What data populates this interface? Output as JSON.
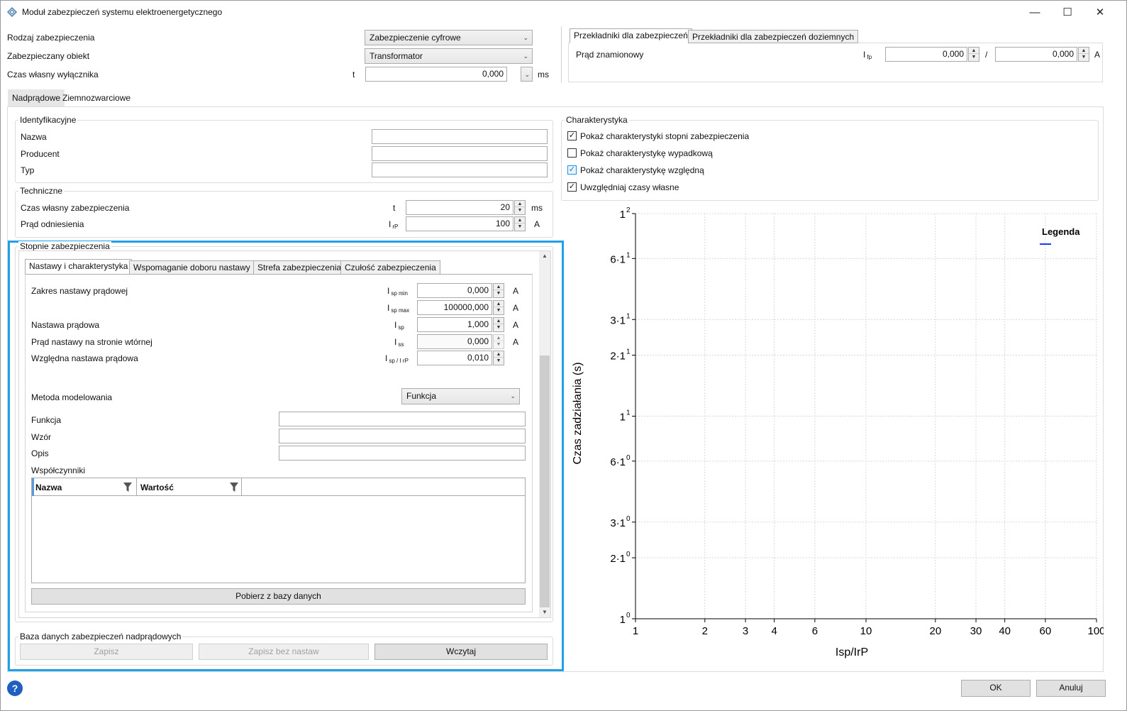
{
  "window": {
    "title": "Moduł zabezpieczeń systemu elektroenergetycznego",
    "minimize": "—",
    "maximize": "☐",
    "close": "✕"
  },
  "top": {
    "type_label": "Rodzaj zabezpieczenia",
    "type_value": "Zabezpieczenie cyfrowe",
    "object_label": "Zabezpieczany obiekt",
    "object_value": "Transformator",
    "breaker_label": "Czas własny wyłącznika",
    "breaker_sym": "t",
    "breaker_value": "0,000",
    "breaker_unit": "ms"
  },
  "transformers": {
    "tabs": [
      "Przekładniki dla zabezpieczeń",
      "Przekładniki dla zabezpieczeń doziemnych"
    ],
    "rated_label": "Prąd znamionowy",
    "sym": "I",
    "sym_sub": "fp",
    "value1": "0,000",
    "sep": "/",
    "value2": "0,000",
    "unit": "A"
  },
  "main_tabs": [
    "Nadprądowe",
    "Ziemnozwarciowe"
  ],
  "ident": {
    "title": "Identyfikacyjne",
    "name_label": "Nazwa",
    "producer_label": "Producent",
    "type_label": "Typ"
  },
  "tech": {
    "title": "Techniczne",
    "own_time_label": "Czas własny zabezpieczenia",
    "own_time_sym": "t",
    "own_time_value": "20",
    "own_time_unit": "ms",
    "ref_label": "Prąd odniesienia",
    "ref_sym": "I",
    "ref_sub": "rP",
    "ref_value": "100",
    "ref_unit": "A"
  },
  "stages": {
    "title": "Stopnie zabezpieczenia",
    "tabs": [
      "Nastawy i charakterystyka",
      "Wspomaganie doboru nastawy",
      "Strefa zabezpieczenia",
      "Czułość zabezpieczenia"
    ],
    "range_label": "Zakres nastawy prądowej",
    "min_sym": "I",
    "min_sub": "sp min",
    "min_value": "0,000",
    "min_unit": "A",
    "max_sym": "I",
    "max_sub": "sp max",
    "max_value": "100000,000",
    "max_unit": "A",
    "setting_label": "Nastawa prądowa",
    "setting_sym": "I",
    "setting_sub": "sp",
    "setting_value": "1,000",
    "setting_unit": "A",
    "secondary_label": "Prąd nastawy na stronie wtórnej",
    "secondary_sym": "I",
    "secondary_sub": "ss",
    "secondary_value": "0,000",
    "secondary_unit": "A",
    "relative_label": "Względna nastawa prądowa",
    "relative_sym": "I",
    "relative_sub": "sp / I rP",
    "relative_value": "0,010",
    "method_label": "Metoda modelowania",
    "method_value": "Funkcja",
    "function_label": "Funkcja",
    "formula_label": "Wzór",
    "desc_label": "Opis",
    "coef_label": "Współczynniki",
    "grid_cols": [
      "Nazwa",
      "Wartość"
    ],
    "fetch_button": "Pobierz z bazy danych"
  },
  "db": {
    "title": "Baza danych zabezpieczeń nadprądowych",
    "save": "Zapisz",
    "save_no": "Zapisz bez nastaw",
    "load": "Wczytaj"
  },
  "charakter": {
    "title": "Charakterystyka",
    "items": [
      {
        "label": "Pokaż charakterystyki stopni zabezpieczenia",
        "checked": "✓"
      },
      {
        "label": "Pokaż charakterystykę wypadkową",
        "checked": ""
      },
      {
        "label": "Pokaż charakterystykę względną",
        "checked": "✓"
      },
      {
        "label": "Uwzględniaj czasy własne",
        "checked": "✓"
      }
    ]
  },
  "chart_data": {
    "type": "line",
    "xlabel": "Isp/IrP",
    "ylabel": "Czas zadziałania (s)",
    "xscale": "log",
    "yscale": "log",
    "xlim": [
      1,
      100
    ],
    "ylim": [
      1,
      100
    ],
    "xticks": [
      1,
      2,
      3,
      4,
      6,
      10,
      20,
      30,
      40,
      60,
      100
    ],
    "xtick_labels": [
      "1",
      "2",
      "3",
      "4",
      "6",
      "10",
      "20",
      "30",
      "40",
      "60",
      "100"
    ],
    "yticks": [
      1,
      2,
      3,
      6,
      10,
      20,
      30,
      60,
      100
    ],
    "ytick_mant": [
      "1",
      "2·1",
      "3·1",
      "6·1",
      "1",
      "2·1",
      "3·1",
      "6·1",
      "1"
    ],
    "ytick_exp": [
      "0",
      "0",
      "0",
      "0",
      "1",
      "1",
      "1",
      "1",
      "2"
    ],
    "grid": true,
    "legend_title": "Legenda",
    "legend_placement": "top-right",
    "series": [],
    "line_color": "#1a3cff"
  },
  "bottom": {
    "help_icon": "?",
    "ok": "OK",
    "cancel": "Anuluj"
  }
}
